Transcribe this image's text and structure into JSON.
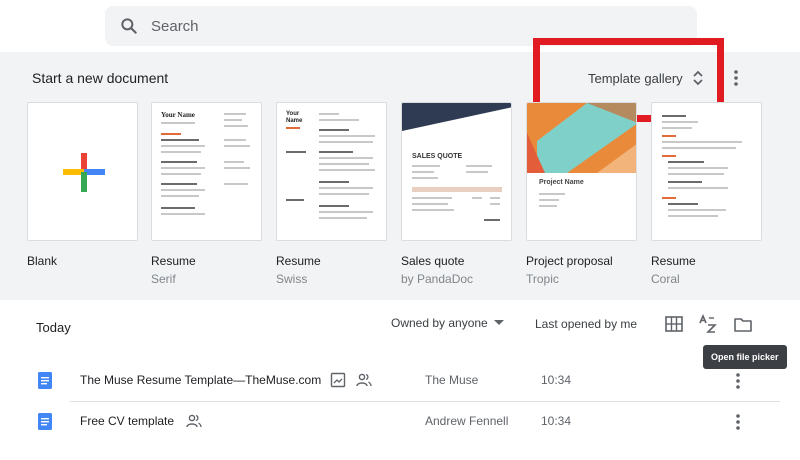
{
  "search": {
    "placeholder": "Search"
  },
  "templates_section": {
    "title": "Start a new document",
    "gallery_label": "Template gallery",
    "items": [
      {
        "name": "Blank",
        "sub": ""
      },
      {
        "name": "Resume",
        "sub": "Serif",
        "thumb_heading": "Your Name"
      },
      {
        "name": "Resume",
        "sub": "Swiss",
        "thumb_heading": "Your Name"
      },
      {
        "name": "Sales quote",
        "sub": "by PandaDoc",
        "thumb_heading": "SALES QUOTE"
      },
      {
        "name": "Project proposal",
        "sub": "Tropic",
        "thumb_heading": "Project Name"
      },
      {
        "name": "Resume",
        "sub": "Coral",
        "thumb_heading": ""
      }
    ]
  },
  "recent": {
    "title": "Today",
    "owner_filter": "Owned by anyone",
    "sort_label": "Last opened by me",
    "tooltip": "Open file picker",
    "rows": [
      {
        "title": "The Muse Resume Template—TheMuse.com",
        "owner": "The Muse",
        "time": "10:34"
      },
      {
        "title": "Free CV template",
        "owner": "Andrew Fennell",
        "time": "10:34"
      }
    ]
  },
  "colors": {
    "section_bg": "#f1f3f4",
    "doc_blue": "#4285f4",
    "highlight_red": "#e01b22",
    "plus_red": "#ea4335",
    "plus_blue": "#4285f4",
    "plus_yellow": "#fbbc04",
    "plus_green": "#34a853"
  },
  "icons": [
    "search-icon",
    "unfold-icon",
    "more-vert-icon",
    "grid-view-icon",
    "sort-az-icon",
    "folder-icon",
    "docs-file-icon",
    "image-icon",
    "shared-people-icon"
  ]
}
